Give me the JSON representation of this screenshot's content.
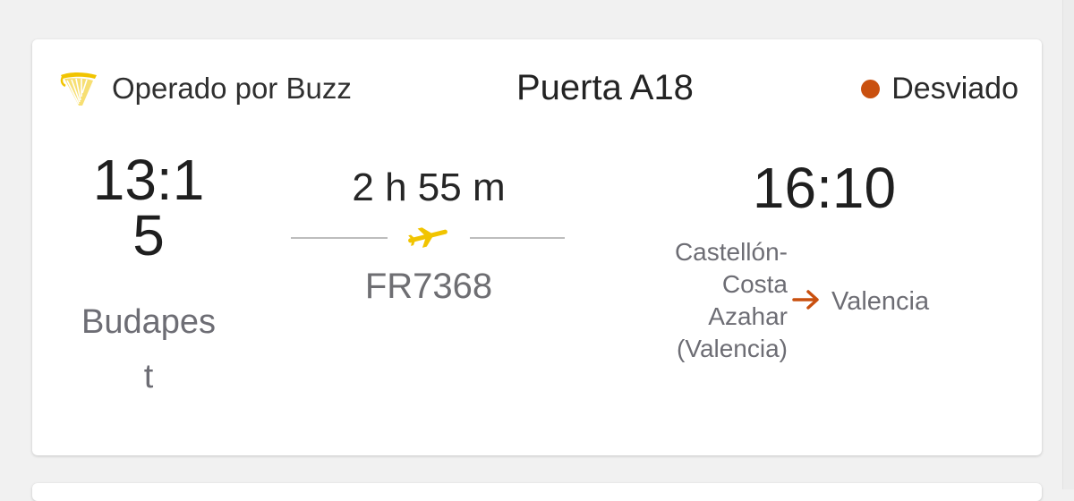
{
  "header": {
    "operated_by": "Operado por Buzz",
    "gate": "Puerta A18",
    "status": "Desviado"
  },
  "departure": {
    "time": "13:15",
    "city": "Budapest"
  },
  "flight": {
    "duration": "2 h 55 m",
    "number": "FR7368"
  },
  "arrival": {
    "time": "16:10",
    "original_destination": "Castellón-Costa Azahar (Valencia)",
    "diverted_to": "Valencia"
  },
  "icons": {
    "airline_logo": "harp-logo-icon",
    "status": "status-dot-icon",
    "plane": "airplane-icon",
    "diversion": "arrow-right-icon"
  },
  "colors": {
    "brand_yellow": "#f1c400",
    "status_orange": "#c9500f",
    "text_primary": "#1f1f1f",
    "text_secondary": "#6d6d74"
  }
}
